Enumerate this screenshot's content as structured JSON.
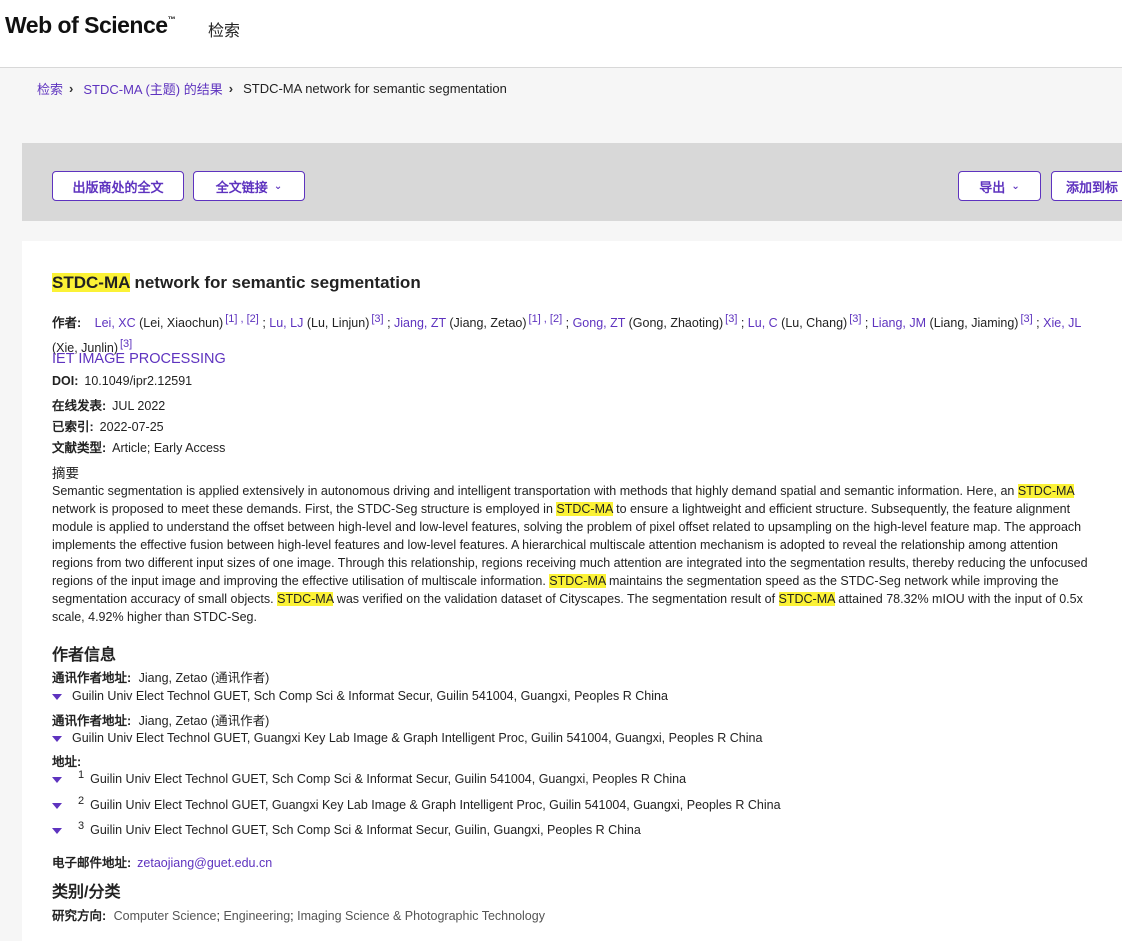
{
  "header": {
    "logo": "Web of Science",
    "logo_tm": "™",
    "nav_search": "检索"
  },
  "breadcrumb": {
    "items": [
      "检索",
      "STDC-MA (主题) 的结果",
      "STDC-MA network for semantic segmentation"
    ]
  },
  "toolbar": {
    "full_text_publisher": "出版商处的全文",
    "full_text_links": "全文链接",
    "export": "导出",
    "add_to": "添加到标"
  },
  "record": {
    "title_hl": "STDC-MA",
    "title_rest": " network for semantic segmentation",
    "authors_label": "作者:",
    "authors": [
      {
        "short": "Lei, XC",
        "full": "(Lei, Xiaochun)",
        "refs": "[1] , [2]"
      },
      {
        "short": "Lu, LJ",
        "full": "(Lu, Linjun)",
        "refs": "[3]"
      },
      {
        "short": "Jiang, ZT",
        "full": "(Jiang, Zetao)",
        "refs": "[1] , [2]"
      },
      {
        "short": "Gong, ZT",
        "full": "(Gong, Zhaoting)",
        "refs": "[3]"
      },
      {
        "short": "Lu, C",
        "full": "(Lu, Chang)",
        "refs": "[3]"
      },
      {
        "short": "Liang, JM",
        "full": "(Liang, Jiaming)",
        "refs": "[3]"
      },
      {
        "short": "Xie, JL",
        "full": "(Xie, Junlin)",
        "refs": "[3]"
      }
    ],
    "journal": "IET IMAGE PROCESSING",
    "doi_label": "DOI:",
    "doi": "10.1049/ipr2.12591",
    "online_label": "在线发表:",
    "online": "JUL 2022",
    "indexed_label": "已索引:",
    "indexed": "2022-07-25",
    "doctype_label": "文献类型:",
    "doctype": "Article; Early Access",
    "abstract_label": "摘要",
    "abstract_parts": [
      "Semantic segmentation is applied extensively in autonomous driving and intelligent transportation with methods that highly demand spatial and semantic information. Here, an ",
      "STDC-MA",
      " network is proposed to meet these demands. First, the STDC-Seg structure is employed in ",
      "STDC-MA",
      " to ensure a lightweight and efficient structure. Subsequently, the feature alignment module is applied to understand the offset between high-level and low-level features, solving the problem of pixel offset related to upsampling on the high-level feature map. The approach implements the effective fusion between high-level features and low-level features. A hierarchical multiscale attention mechanism is adopted to reveal the relationship among attention regions from two different input sizes of one image. Through this relationship, regions receiving much attention are integrated into the segmentation results, thereby reducing the unfocused regions of the input image and improving the effective utilisation of multiscale information. ",
      "STDC-MA",
      " maintains the segmentation speed as the STDC-Seg network while improving the segmentation accuracy of small objects. ",
      "STDC-MA",
      " was verified on the validation dataset of Cityscapes. The segmentation result of ",
      "STDC-MA",
      " attained 78.32% mIOU with the input of 0.5x scale, 4.92% higher than STDC-Seg."
    ]
  },
  "author_info": {
    "heading": "作者信息",
    "corr1_label": "通讯作者地址:",
    "corr1_name": "Jiang, Zetao",
    "corr1_role": "(通讯作者)",
    "corr1_addr": "Guilin Univ Elect Technol GUET, Sch Comp Sci & Informat Secur, Guilin 541004, Guangxi, Peoples R China",
    "corr2_label": "通讯作者地址:",
    "corr2_name": "Jiang, Zetao",
    "corr2_role": "(通讯作者)",
    "corr2_addr": "Guilin Univ Elect Technol GUET, Guangxi Key Lab Image & Graph Intelligent Proc, Guilin 541004, Guangxi, Peoples R China",
    "addr_label": "地址:",
    "addresses": [
      {
        "n": "1",
        "text": "Guilin Univ Elect Technol GUET, Sch Comp Sci & Informat Secur, Guilin 541004, Guangxi, Peoples R China"
      },
      {
        "n": "2",
        "text": "Guilin Univ Elect Technol GUET, Guangxi Key Lab Image & Graph Intelligent Proc, Guilin 541004, Guangxi, Peoples R China"
      },
      {
        "n": "3",
        "text": "Guilin Univ Elect Technol GUET, Sch Comp Sci & Informat Secur, Guilin, Guangxi, Peoples R China"
      }
    ],
    "email_label": "电子邮件地址:",
    "email": "zetaojiang@guet.edu.cn"
  },
  "categories": {
    "heading": "类别/分类",
    "research_label": "研究方向:",
    "areas": [
      "Computer Science",
      "Engineering",
      "Imaging Science & Photographic Technology"
    ],
    "sep": "; "
  },
  "colors": {
    "accent": "#5e33bf",
    "highlight": "#fbf236",
    "toolbar_bg": "#d8d8d8"
  },
  "icons": {
    "dropdown": "chevron-down-icon",
    "expand": "caret-down-icon",
    "breadcrumb_sep": "chevron-right-icon"
  }
}
